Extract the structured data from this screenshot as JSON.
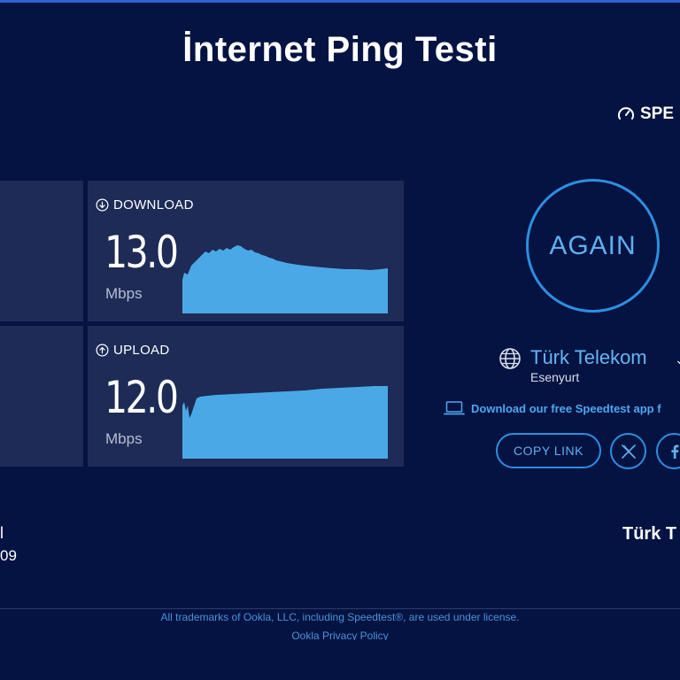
{
  "page": {
    "title": "İnternet Ping Testi"
  },
  "brand": {
    "label": "SPE",
    "icon": "speedometer-icon"
  },
  "results": {
    "download": {
      "label": "DOWNLOAD",
      "value": "13.0",
      "unit": "Mbps",
      "icon": "download-arrow-icon",
      "graph_color": "#4aa8e6"
    },
    "upload": {
      "label": "UPLOAD",
      "value": "12.0",
      "unit": "Mbps",
      "icon": "upload-arrow-icon",
      "graph_color": "#4aa8e6"
    }
  },
  "actions": {
    "again_label": "AGAIN",
    "app_link": "Download our free Speedtest app f",
    "copy_link": "COPY LINK",
    "share_x_icon": "x-icon",
    "share_facebook_icon": "facebook-icon"
  },
  "provider": {
    "name": "Türk Telekom",
    "location": "Esenyurt",
    "icon": "globe-icon"
  },
  "fragments": {
    "left_top": "l",
    "left_bottom": "09",
    "right": "Türk T"
  },
  "footer": {
    "trademark": "All trademarks of Ookla, LLC, including Speedtest®, are used under license.",
    "privacy": "Ookla Privacy Policy"
  },
  "colors": {
    "background": "#041342",
    "panel": "#1d2b56",
    "accent": "#2d8fe0",
    "accent_text": "#5fb0ef"
  }
}
